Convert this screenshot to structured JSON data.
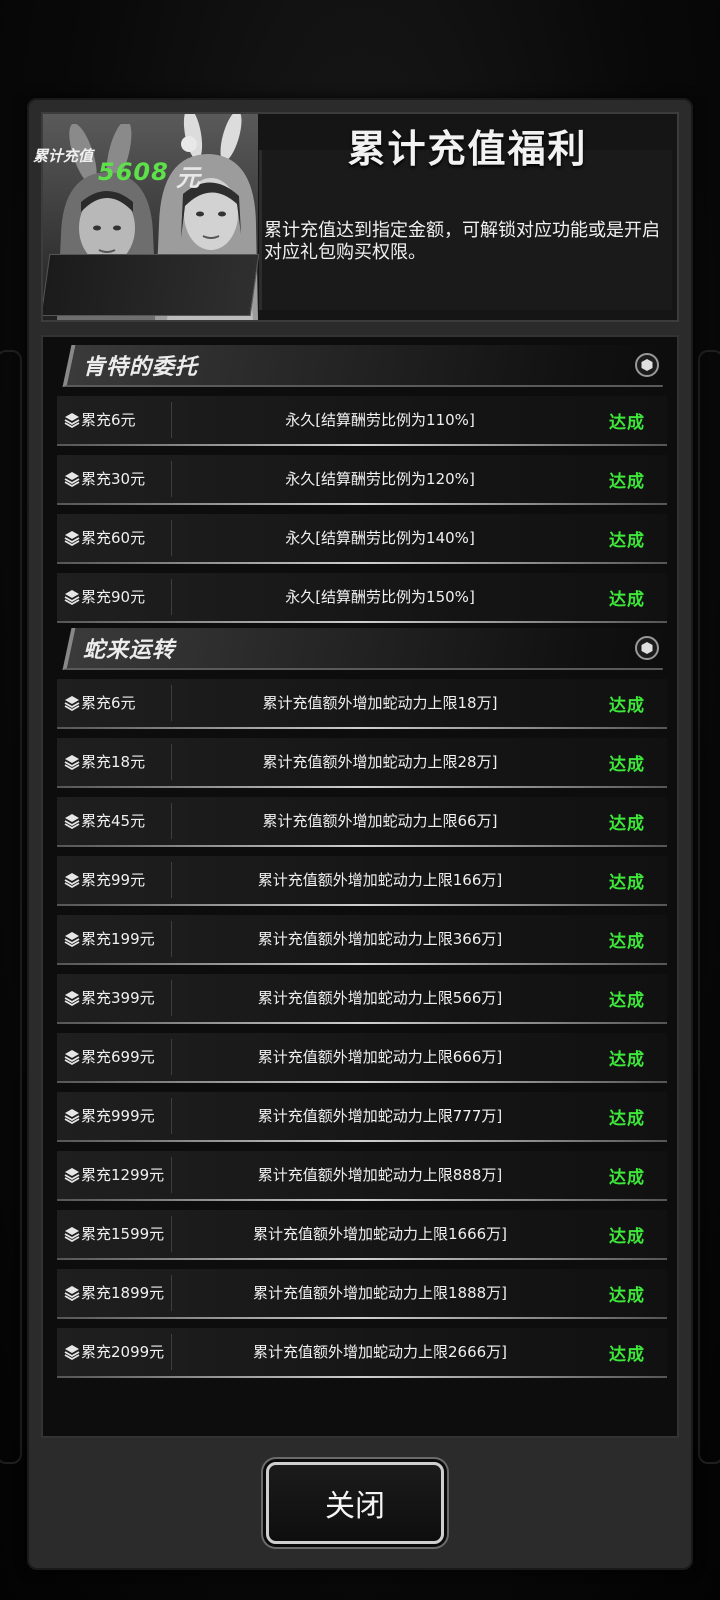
{
  "header": {
    "title": "累计充值福利",
    "description": "累计充值达到指定金额，可解锁对应功能或是开启对应礼包购买权限。",
    "total_label": "累计充值",
    "total_amount": "5608",
    "total_unit": "元"
  },
  "sections": [
    {
      "title": "肯特的委托",
      "icon": "hexagon-icon",
      "rows": [
        {
          "threshold": "累充6元",
          "desc": "永久[结算酬劳比例为110%]",
          "status": "达成"
        },
        {
          "threshold": "累充30元",
          "desc": "永久[结算酬劳比例为120%]",
          "status": "达成"
        },
        {
          "threshold": "累充60元",
          "desc": "永久[结算酬劳比例为140%]",
          "status": "达成"
        },
        {
          "threshold": "累充90元",
          "desc": "永久[结算酬劳比例为150%]",
          "status": "达成"
        }
      ]
    },
    {
      "title": "蛇来运转",
      "icon": "hexagon-icon",
      "rows": [
        {
          "threshold": "累充6元",
          "desc": "累计充值额外增加蛇动力上限18万]",
          "status": "达成"
        },
        {
          "threshold": "累充18元",
          "desc": "累计充值额外增加蛇动力上限28万]",
          "status": "达成"
        },
        {
          "threshold": "累充45元",
          "desc": "累计充值额外增加蛇动力上限66万]",
          "status": "达成"
        },
        {
          "threshold": "累充99元",
          "desc": "累计充值额外增加蛇动力上限166万]",
          "status": "达成"
        },
        {
          "threshold": "累充199元",
          "desc": "累计充值额外增加蛇动力上限366万]",
          "status": "达成"
        },
        {
          "threshold": "累充399元",
          "desc": "累计充值额外增加蛇动力上限566万]",
          "status": "达成"
        },
        {
          "threshold": "累充699元",
          "desc": "累计充值额外增加蛇动力上限666万]",
          "status": "达成"
        },
        {
          "threshold": "累充999元",
          "desc": "累计充值额外增加蛇动力上限777万]",
          "status": "达成"
        },
        {
          "threshold": "累充1299元",
          "desc": "累计充值额外增加蛇动力上限888万]",
          "status": "达成"
        },
        {
          "threshold": "累充1599元",
          "desc": "累计充值额外增加蛇动力上限1666万]",
          "status": "达成"
        },
        {
          "threshold": "累充1899元",
          "desc": "累计充值额外增加蛇动力上限1888万]",
          "status": "达成"
        },
        {
          "threshold": "累充2099元",
          "desc": "累计充值额外增加蛇动力上限2666万]",
          "status": "达成"
        }
      ]
    }
  ],
  "close_label": "关闭",
  "colors": {
    "status": "#3ee83a",
    "amount": "#5ee04a"
  }
}
